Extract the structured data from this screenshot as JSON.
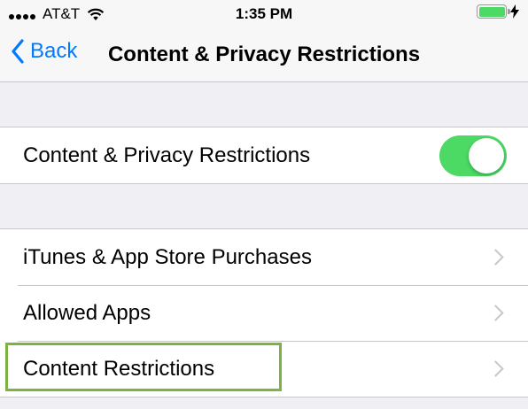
{
  "status_bar": {
    "carrier": "AT&T",
    "time": "1:35 PM",
    "battery_color": "#4cd964"
  },
  "nav": {
    "back_label": "Back",
    "title": "Content & Privacy Restrictions"
  },
  "toggle_row": {
    "label": "Content & Privacy Restrictions",
    "enabled": true
  },
  "menu": {
    "items": [
      {
        "label": "iTunes & App Store Purchases"
      },
      {
        "label": "Allowed Apps"
      },
      {
        "label": "Content Restrictions"
      }
    ]
  },
  "highlight": {
    "target": "Content Restrictions",
    "color": "#7cb342"
  },
  "colors": {
    "accent": "#007aff",
    "switch_on": "#4cd964",
    "background": "#efeff4"
  }
}
